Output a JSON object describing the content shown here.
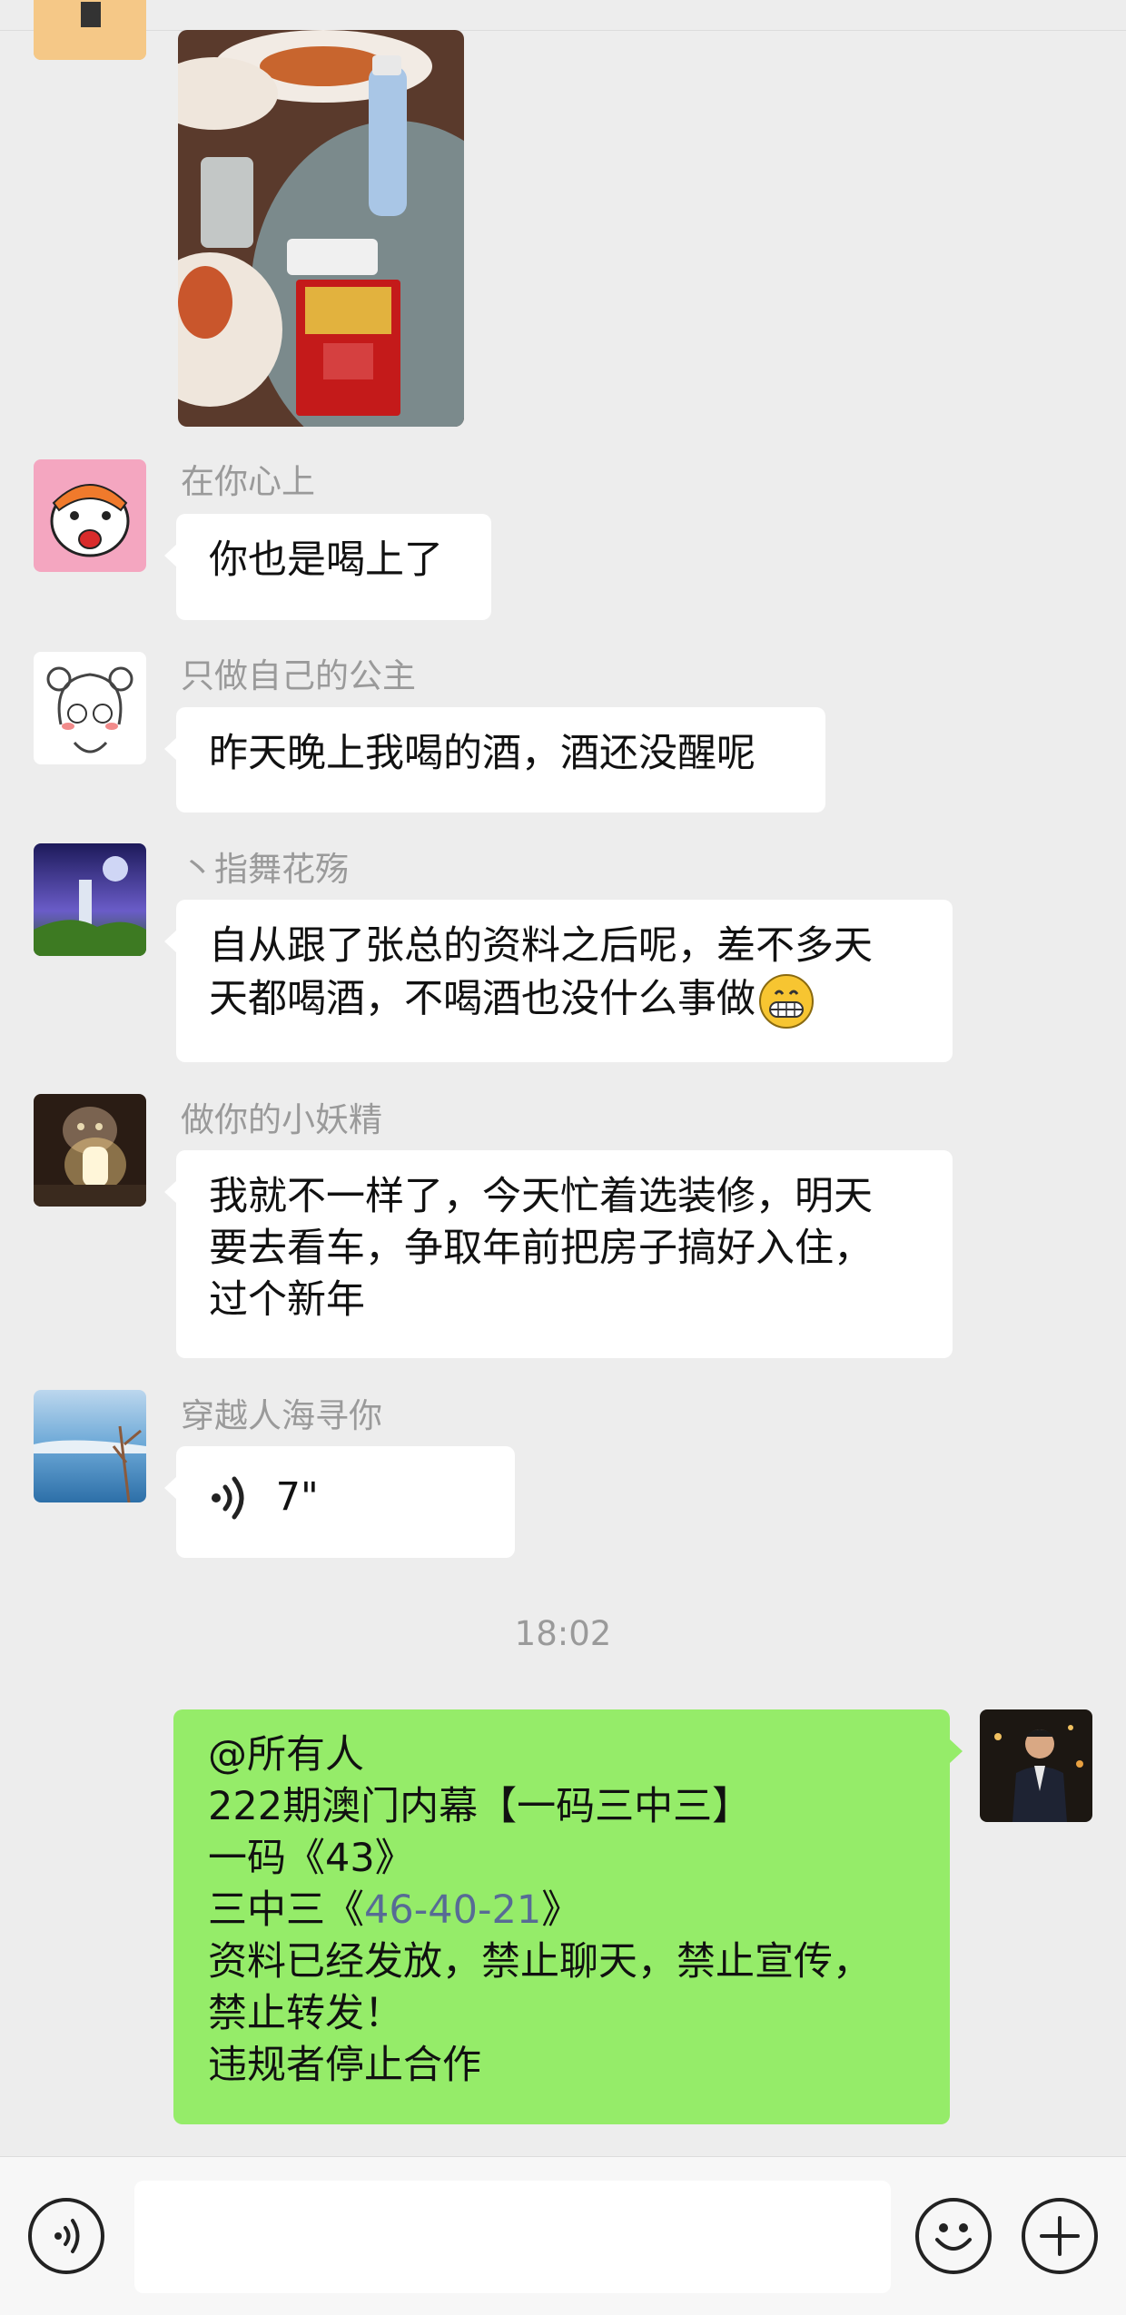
{
  "messages": [
    {
      "sender": "在你心上",
      "text": "你也是喝上了"
    },
    {
      "sender": "只做自己的公主",
      "text": "昨天晚上我喝的酒，酒还没醒呢"
    },
    {
      "sender": "丶指舞花殇",
      "lines": [
        "自从跟了张总的资料之后呢，差不多天",
        "天都喝酒，不喝酒也没什么事做"
      ]
    },
    {
      "sender": "做你的小妖精",
      "lines": [
        "我就不一样了，今天忙着选装修，明天",
        "要去看车，争取年前把房子搞好入住，",
        "过个新年"
      ]
    },
    {
      "sender": "穿越人海寻你",
      "voice_duration": "7\""
    }
  ],
  "time_divider": "18:02",
  "my_message": {
    "line1": "@所有人",
    "line2": "222期澳门内幕【一码三中三】",
    "line3": "一码《43》",
    "line4_prefix": "三中三《",
    "line4_link": "46-40-21",
    "line4_suffix": "》",
    "line5": "资料已经发放，禁止聊天，禁止宣传，",
    "line6": "禁止转发！",
    "line7": "违规者停止合作"
  },
  "input": {
    "value": ""
  },
  "icons": {
    "voice_toggle": "voice-icon",
    "emoji": "emoji-icon",
    "more": "plus-icon"
  },
  "colors": {
    "my_bubble": "#95ec69",
    "link": "#576b95",
    "background": "#ededed"
  }
}
